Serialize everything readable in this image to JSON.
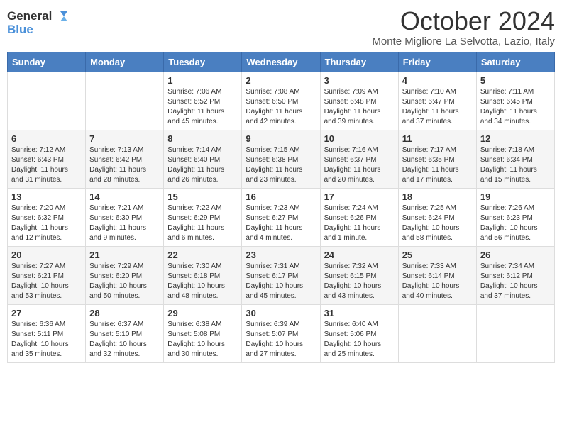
{
  "header": {
    "logo_line1": "General",
    "logo_line2": "Blue",
    "month_title": "October 2024",
    "location": "Monte Migliore La Selvotta, Lazio, Italy"
  },
  "days_of_week": [
    "Sunday",
    "Monday",
    "Tuesday",
    "Wednesday",
    "Thursday",
    "Friday",
    "Saturday"
  ],
  "weeks": [
    [
      {
        "day": "",
        "info": ""
      },
      {
        "day": "",
        "info": ""
      },
      {
        "day": "1",
        "info": "Sunrise: 7:06 AM\nSunset: 6:52 PM\nDaylight: 11 hours and 45 minutes."
      },
      {
        "day": "2",
        "info": "Sunrise: 7:08 AM\nSunset: 6:50 PM\nDaylight: 11 hours and 42 minutes."
      },
      {
        "day": "3",
        "info": "Sunrise: 7:09 AM\nSunset: 6:48 PM\nDaylight: 11 hours and 39 minutes."
      },
      {
        "day": "4",
        "info": "Sunrise: 7:10 AM\nSunset: 6:47 PM\nDaylight: 11 hours and 37 minutes."
      },
      {
        "day": "5",
        "info": "Sunrise: 7:11 AM\nSunset: 6:45 PM\nDaylight: 11 hours and 34 minutes."
      }
    ],
    [
      {
        "day": "6",
        "info": "Sunrise: 7:12 AM\nSunset: 6:43 PM\nDaylight: 11 hours and 31 minutes."
      },
      {
        "day": "7",
        "info": "Sunrise: 7:13 AM\nSunset: 6:42 PM\nDaylight: 11 hours and 28 minutes."
      },
      {
        "day": "8",
        "info": "Sunrise: 7:14 AM\nSunset: 6:40 PM\nDaylight: 11 hours and 26 minutes."
      },
      {
        "day": "9",
        "info": "Sunrise: 7:15 AM\nSunset: 6:38 PM\nDaylight: 11 hours and 23 minutes."
      },
      {
        "day": "10",
        "info": "Sunrise: 7:16 AM\nSunset: 6:37 PM\nDaylight: 11 hours and 20 minutes."
      },
      {
        "day": "11",
        "info": "Sunrise: 7:17 AM\nSunset: 6:35 PM\nDaylight: 11 hours and 17 minutes."
      },
      {
        "day": "12",
        "info": "Sunrise: 7:18 AM\nSunset: 6:34 PM\nDaylight: 11 hours and 15 minutes."
      }
    ],
    [
      {
        "day": "13",
        "info": "Sunrise: 7:20 AM\nSunset: 6:32 PM\nDaylight: 11 hours and 12 minutes."
      },
      {
        "day": "14",
        "info": "Sunrise: 7:21 AM\nSunset: 6:30 PM\nDaylight: 11 hours and 9 minutes."
      },
      {
        "day": "15",
        "info": "Sunrise: 7:22 AM\nSunset: 6:29 PM\nDaylight: 11 hours and 6 minutes."
      },
      {
        "day": "16",
        "info": "Sunrise: 7:23 AM\nSunset: 6:27 PM\nDaylight: 11 hours and 4 minutes."
      },
      {
        "day": "17",
        "info": "Sunrise: 7:24 AM\nSunset: 6:26 PM\nDaylight: 11 hours and 1 minute."
      },
      {
        "day": "18",
        "info": "Sunrise: 7:25 AM\nSunset: 6:24 PM\nDaylight: 10 hours and 58 minutes."
      },
      {
        "day": "19",
        "info": "Sunrise: 7:26 AM\nSunset: 6:23 PM\nDaylight: 10 hours and 56 minutes."
      }
    ],
    [
      {
        "day": "20",
        "info": "Sunrise: 7:27 AM\nSunset: 6:21 PM\nDaylight: 10 hours and 53 minutes."
      },
      {
        "day": "21",
        "info": "Sunrise: 7:29 AM\nSunset: 6:20 PM\nDaylight: 10 hours and 50 minutes."
      },
      {
        "day": "22",
        "info": "Sunrise: 7:30 AM\nSunset: 6:18 PM\nDaylight: 10 hours and 48 minutes."
      },
      {
        "day": "23",
        "info": "Sunrise: 7:31 AM\nSunset: 6:17 PM\nDaylight: 10 hours and 45 minutes."
      },
      {
        "day": "24",
        "info": "Sunrise: 7:32 AM\nSunset: 6:15 PM\nDaylight: 10 hours and 43 minutes."
      },
      {
        "day": "25",
        "info": "Sunrise: 7:33 AM\nSunset: 6:14 PM\nDaylight: 10 hours and 40 minutes."
      },
      {
        "day": "26",
        "info": "Sunrise: 7:34 AM\nSunset: 6:12 PM\nDaylight: 10 hours and 37 minutes."
      }
    ],
    [
      {
        "day": "27",
        "info": "Sunrise: 6:36 AM\nSunset: 5:11 PM\nDaylight: 10 hours and 35 minutes."
      },
      {
        "day": "28",
        "info": "Sunrise: 6:37 AM\nSunset: 5:10 PM\nDaylight: 10 hours and 32 minutes."
      },
      {
        "day": "29",
        "info": "Sunrise: 6:38 AM\nSunset: 5:08 PM\nDaylight: 10 hours and 30 minutes."
      },
      {
        "day": "30",
        "info": "Sunrise: 6:39 AM\nSunset: 5:07 PM\nDaylight: 10 hours and 27 minutes."
      },
      {
        "day": "31",
        "info": "Sunrise: 6:40 AM\nSunset: 5:06 PM\nDaylight: 10 hours and 25 minutes."
      },
      {
        "day": "",
        "info": ""
      },
      {
        "day": "",
        "info": ""
      }
    ]
  ]
}
